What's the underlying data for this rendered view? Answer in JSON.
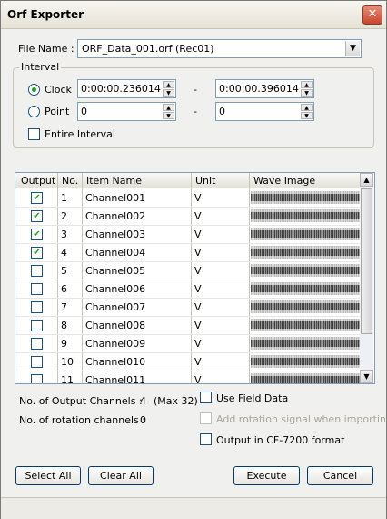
{
  "window": {
    "title": "Orf Exporter",
    "close_glyph": "✕"
  },
  "file": {
    "label": "File Name :",
    "value": "ORF_Data_001.orf (Rec01)"
  },
  "interval": {
    "group_label": "Interval",
    "clock_label": "Clock",
    "point_label": "Point",
    "clock_start": "0:00:00.236014",
    "clock_end": "0:00:00.396014",
    "point_start": "0",
    "point_end": "0",
    "separator": "-",
    "entire_label": "Entire Interval",
    "selected_mode": "Clock",
    "entire_checked": false
  },
  "table": {
    "headers": {
      "output": "Output",
      "no": "No.",
      "item": "Item Name",
      "unit": "Unit",
      "wave": "Wave Image"
    },
    "rows": [
      {
        "checked": true,
        "no": "1",
        "name": "Channel001",
        "unit": "V"
      },
      {
        "checked": true,
        "no": "2",
        "name": "Channel002",
        "unit": "V"
      },
      {
        "checked": true,
        "no": "3",
        "name": "Channel003",
        "unit": "V"
      },
      {
        "checked": true,
        "no": "4",
        "name": "Channel004",
        "unit": "V"
      },
      {
        "checked": false,
        "no": "5",
        "name": "Channel005",
        "unit": "V"
      },
      {
        "checked": false,
        "no": "6",
        "name": "Channel006",
        "unit": "V"
      },
      {
        "checked": false,
        "no": "7",
        "name": "Channel007",
        "unit": "V"
      },
      {
        "checked": false,
        "no": "8",
        "name": "Channel008",
        "unit": "V"
      },
      {
        "checked": false,
        "no": "9",
        "name": "Channel009",
        "unit": "V"
      },
      {
        "checked": false,
        "no": "10",
        "name": "Channel010",
        "unit": "V"
      },
      {
        "checked": false,
        "no": "11",
        "name": "Channel011",
        "unit": "V"
      }
    ]
  },
  "summary": {
    "output_channels_label": "No. of Output Channels :",
    "output_channels_value": "4",
    "output_channels_max": "(Max 32)",
    "rotation_label": "No. of rotation channels :",
    "rotation_value": "0"
  },
  "options": {
    "use_field_data": "Use Field Data",
    "add_rotation": "Add rotation signal when importing",
    "cf7200": "Output in CF-7200 format"
  },
  "buttons": {
    "select_all": "Select All",
    "clear_all": "Clear All",
    "execute": "Execute",
    "cancel": "Cancel"
  },
  "colors": {
    "check_green": "#21a121",
    "border_blue": "#7f9db9",
    "close_red": "#c9452b"
  }
}
